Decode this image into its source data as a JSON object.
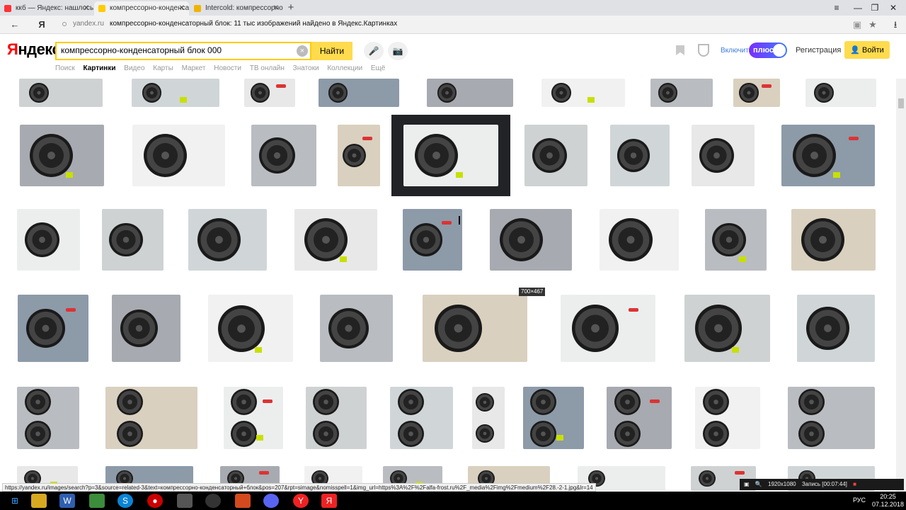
{
  "tabs": [
    {
      "title": "ккб — Яндекс: нашлось 51...",
      "favicon_color": "#f33",
      "active": false
    },
    {
      "title": "компрессорно-конденса...",
      "favicon_color": "#ffcc00",
      "active": true
    },
    {
      "title": "Intercold: компрессорно-к...",
      "favicon_color": "#f0b400",
      "active": false
    }
  ],
  "window": {
    "new_tab": "+",
    "menu": "≡",
    "minimize": "—",
    "maximize": "❐",
    "close": "✕"
  },
  "address": {
    "back": "←",
    "yandex_mark": "Я",
    "host": "yandex.ru",
    "title": "компрессорно-конденсаторный блок: 11 тыс изображений найдено в Яндекс.Картинках",
    "star": "★",
    "download": "⭳"
  },
  "header": {
    "logo_first": "Я",
    "logo_rest": "ндекс",
    "search_value": "компрессорно-конденсаторный блок 000",
    "clear": "×",
    "search_button": "Найти",
    "mic": "🎤",
    "camera": "📷",
    "plus_enable": "Включить",
    "plus_label": "плюс",
    "register": "Регистрация",
    "login": "Войти"
  },
  "services": [
    {
      "label": "Поиск",
      "active": false
    },
    {
      "label": "Картинки",
      "active": true
    },
    {
      "label": "Видео",
      "active": false
    },
    {
      "label": "Карты",
      "active": false
    },
    {
      "label": "Маркет",
      "active": false
    },
    {
      "label": "Новости",
      "active": false
    },
    {
      "label": "ТВ онлайн",
      "active": false
    },
    {
      "label": "Знатоки",
      "active": false
    },
    {
      "label": "Коллекции",
      "active": false
    },
    {
      "label": "Ещё",
      "active": false
    }
  ],
  "size_badge": "700×467",
  "status_url": "https://yandex.ru/images/search?p=3&source=related-3&text=компрессорно-конденсаторный+блок&pos=207&rpt=simage&nomisspell=1&img_url=https%3A%2F%2Falfa-frost.ru%2F_media%2Fimg%2Fmedium%2F28.-2-1.jpg&lr=14",
  "recorder": {
    "resolution": "1920x1080",
    "record": "Запись [00:07:44]"
  },
  "tray": {
    "lang": "РУС",
    "time": "20:25",
    "date": "07.12.2018"
  }
}
